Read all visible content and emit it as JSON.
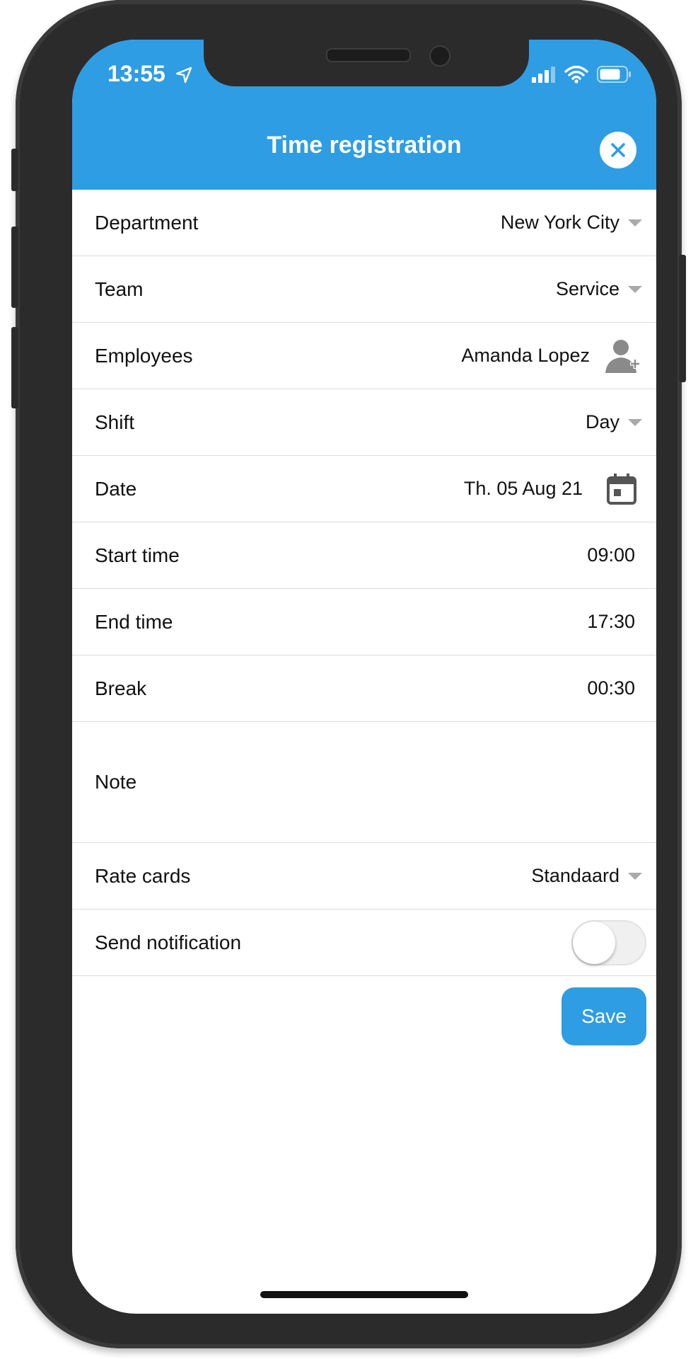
{
  "status_bar": {
    "time": "13:55"
  },
  "header": {
    "title": "Time registration"
  },
  "rows": {
    "department": {
      "label": "Department",
      "value": "New York City"
    },
    "team": {
      "label": "Team",
      "value": "Service"
    },
    "employees": {
      "label": "Employees",
      "value": "Amanda Lopez"
    },
    "shift": {
      "label": "Shift",
      "value": "Day"
    },
    "date": {
      "label": "Date",
      "value": "Th. 05 Aug 21"
    },
    "start_time": {
      "label": "Start time",
      "value": "09:00"
    },
    "end_time": {
      "label": "End time",
      "value": "17:30"
    },
    "break": {
      "label": "Break",
      "value": "00:30"
    },
    "note": {
      "label": "Note"
    },
    "rate_cards": {
      "label": "Rate cards",
      "value": "Standaard"
    },
    "send_notification": {
      "label": "Send notification",
      "enabled": false
    }
  },
  "actions": {
    "save_label": "Save"
  },
  "colors": {
    "accent": "#2e9de4",
    "frame": "#2b2b2b"
  }
}
